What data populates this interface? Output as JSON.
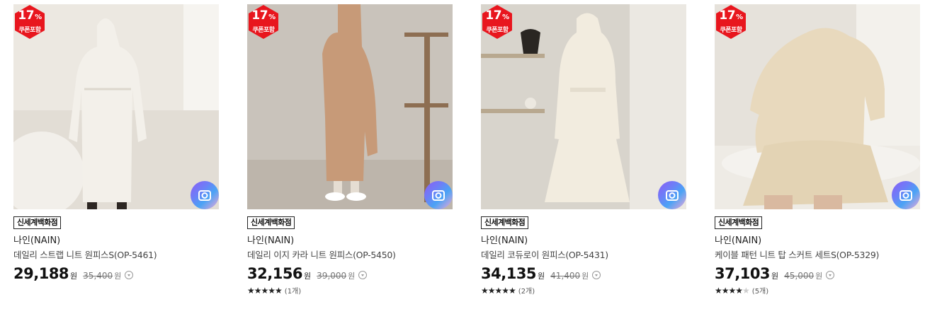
{
  "products": [
    {
      "discount_percent": "17",
      "discount_unit": "%",
      "coupon_label": "쿠폰포함",
      "store_tag": "신세계백화점",
      "brand": "나인(NAIN)",
      "name": "데일리 스트랩 니트 원피스S(OP-5461)",
      "price": "29,188",
      "price_unit": "원",
      "original_price": "35,400",
      "original_unit": "원",
      "stars": "",
      "stars_off": "",
      "review_count": "",
      "image_icon": "camera-icon"
    },
    {
      "discount_percent": "17",
      "discount_unit": "%",
      "coupon_label": "쿠폰포함",
      "store_tag": "신세계백화점",
      "brand": "나인(NAIN)",
      "name": "데일리 이지 카라 니트 원피스(OP-5450)",
      "price": "32,156",
      "price_unit": "원",
      "original_price": "39,000",
      "original_unit": "원",
      "stars": "★★★★★",
      "stars_off": "",
      "review_count": "(1개)",
      "image_icon": "camera-icon"
    },
    {
      "discount_percent": "17",
      "discount_unit": "%",
      "coupon_label": "쿠폰포함",
      "store_tag": "신세계백화점",
      "brand": "나인(NAIN)",
      "name": "데일리 코듀로이 원피스(OP-5431)",
      "price": "34,135",
      "price_unit": "원",
      "original_price": "41,400",
      "original_unit": "원",
      "stars": "★★★★★",
      "stars_off": "",
      "review_count": "(2개)",
      "image_icon": "camera-icon"
    },
    {
      "discount_percent": "17",
      "discount_unit": "%",
      "coupon_label": "쿠폰포함",
      "store_tag": "신세계백화점",
      "brand": "나인(NAIN)",
      "name": "케이블 패턴 니트 탑 스커트 세트S(OP-5329)",
      "price": "37,103",
      "price_unit": "원",
      "original_price": "45,000",
      "original_unit": "원",
      "stars": "★★★★",
      "stars_off": "★",
      "review_count": "(5개)",
      "image_icon": "camera-icon"
    }
  ],
  "colors": {
    "badge_red": "#e8161e",
    "photo_1_bg": "#ece8e1",
    "photo_2_bg": "#c9c3bb",
    "photo_3_bg": "#d8d4cc",
    "photo_4_bg": "#e6e2db"
  }
}
